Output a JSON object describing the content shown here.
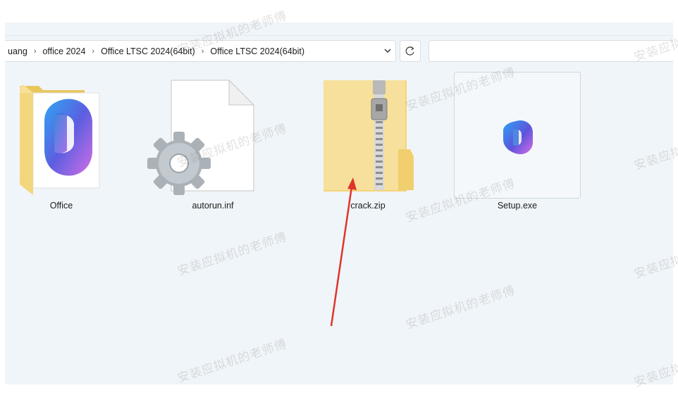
{
  "breadcrumb": {
    "items": [
      "uang",
      "office 2024",
      "Office LTSC 2024(64bit)",
      "Office LTSC 2024(64bit)"
    ]
  },
  "toolbar": {
    "dropdown_icon": "chevron-down-icon",
    "refresh_icon": "refresh-icon"
  },
  "files": [
    {
      "name": "Office",
      "icon": "folder-office-icon"
    },
    {
      "name": "autorun.inf",
      "icon": "settings-file-icon"
    },
    {
      "name": "crack.zip",
      "icon": "zip-folder-icon"
    },
    {
      "name": "Setup.exe",
      "icon": "office-app-icon",
      "selected": true
    }
  ],
  "watermark": "安装应拟机的老师傅",
  "colors": {
    "window_bg": "#f0f5f9",
    "folder_yellow": "#f6dd87",
    "arrow_red": "#e0342b",
    "selection_border": "#cfd6dc"
  }
}
